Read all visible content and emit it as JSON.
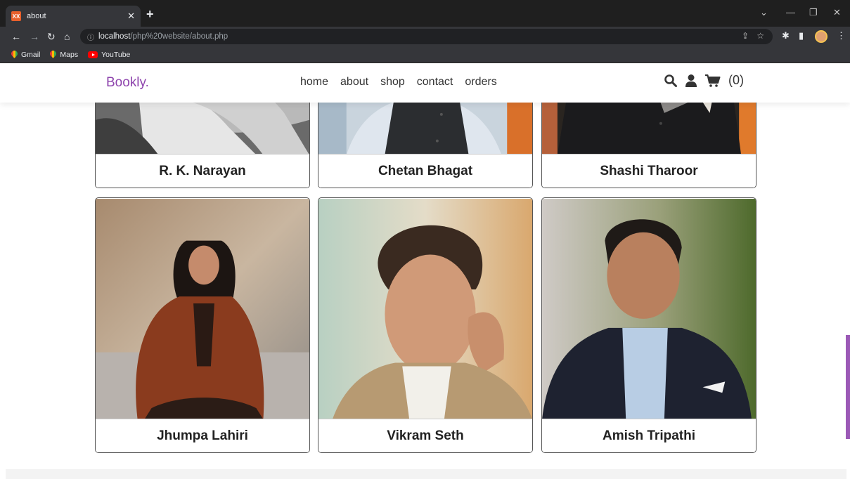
{
  "browser": {
    "tab_title": "about",
    "tab_favicon_text": "XX",
    "url_host": "localhost",
    "url_path": "/php%20website/about.php",
    "bookmarks": [
      {
        "label": "Gmail"
      },
      {
        "label": "Maps"
      },
      {
        "label": "YouTube"
      }
    ]
  },
  "site": {
    "logo": "Bookly.",
    "nav": [
      "home",
      "about",
      "shop",
      "contact",
      "orders"
    ],
    "cart_count": "(0)",
    "accent_color": "#8e44ad"
  },
  "authors": [
    {
      "name": "R. K. Narayan"
    },
    {
      "name": "Chetan Bhagat"
    },
    {
      "name": "Shashi Tharoor"
    },
    {
      "name": "Jhumpa Lahiri"
    },
    {
      "name": "Vikram Seth"
    },
    {
      "name": "Amish Tripathi"
    }
  ]
}
